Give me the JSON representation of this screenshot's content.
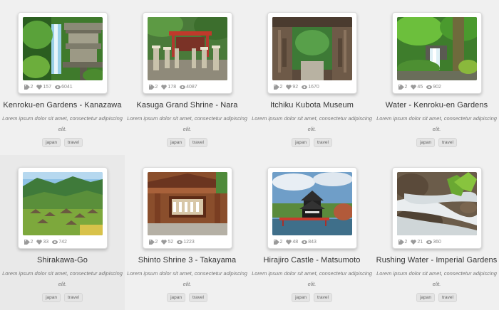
{
  "items": [
    {
      "title": "Kenroku-en Gardens - Kanazawa",
      "tags": 2,
      "likes": 157,
      "views": 6041
    },
    {
      "title": "Kasuga Grand Shrine - Nara",
      "tags": 2,
      "likes": 178,
      "views": 4087
    },
    {
      "title": "Itchiku Kubota Museum",
      "tags": 2,
      "likes": 92,
      "views": 1670
    },
    {
      "title": "Water - Kenroku-en Gardens",
      "tags": 2,
      "likes": 45,
      "views": 902
    },
    {
      "title": "Shirakawa-Go",
      "tags": 2,
      "likes": 33,
      "views": 742
    },
    {
      "title": "Shinto Shrine 3 - Takayama",
      "tags": 2,
      "likes": 52,
      "views": 1223
    },
    {
      "title": "Hirajiro Castle - Matsumoto",
      "tags": 2,
      "likes": 48,
      "views": 843
    },
    {
      "title": "Rushing Water - Imperial Gardens",
      "tags": 2,
      "likes": 21,
      "views": 360
    }
  ],
  "description": "Lorem ipsum dolor sit amet, consectetur adipiscing elit.",
  "tag_labels": [
    "japan",
    "travel"
  ],
  "icons": {
    "tag": "tag-icon",
    "like": "heart-icon",
    "view": "eye-icon"
  },
  "colors": {
    "background": "#f0f0f0",
    "hover": "#e9e9e9",
    "card": "#ffffff"
  }
}
